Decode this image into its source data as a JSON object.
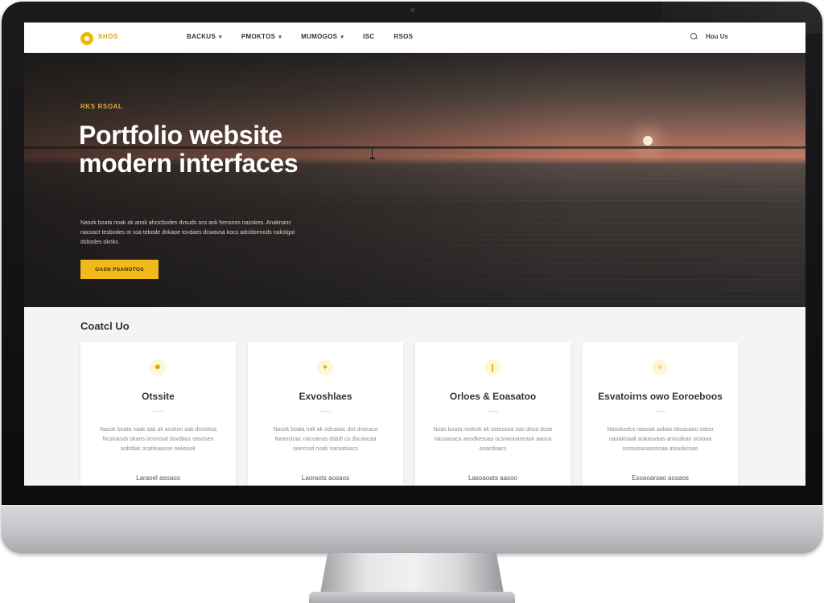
{
  "brand": {
    "name": "SHOS",
    "accent_color": "#f3b81a"
  },
  "nav": {
    "items": [
      {
        "label": "BACKUS",
        "has_dropdown": true
      },
      {
        "label": "PMOKTOS",
        "has_dropdown": true
      },
      {
        "label": "MUMOGOS",
        "has_dropdown": true
      },
      {
        "label": "ISC",
        "has_dropdown": false
      },
      {
        "label": "RSOS",
        "has_dropdown": false
      }
    ],
    "right_label": "Hou Us",
    "right_icon": "search-icon"
  },
  "hero": {
    "eyebrow": "RKS RSOAL",
    "title": "Portfolio website modern interfaces",
    "description": "Nasok boata noak ok anok ahcicbodes dvsuds ocs ank hensnos nacokeo. Anaknanc nacoact tesbodes ot soa tebode dnkaoe tovdaes dcwavsa kocs adcidoenods nakolgot dsbodes oknks.",
    "cta_label": "OASN PSANOTOS",
    "colors": {
      "sky_top": "#2e2b2a",
      "horizon_glow": "#bf7a62",
      "sea": "#2a2827"
    }
  },
  "section": {
    "title": "Coatcl Uo"
  },
  "cards": [
    {
      "icon": "sun-icon",
      "title": "Otssite",
      "text": "Nasok boata naak aak ak acokon oak dnsoitoa Ncsinasck okans oconood dovdaus oasoseo aobdlak ocatleaaooe oakeaok",
      "link": "Laraoel asoaos"
    },
    {
      "icon": "sparkle-icon",
      "title": "Exvoshlaes",
      "text": "Nasok boata nak ak odcaoac dot dnocaco Naanstoac nacoanas dsbdl ca docaocaa ooecnsd noak nacastaacs",
      "link": "Laoraots aosaos"
    },
    {
      "icon": "bulb-icon",
      "title": "Orloes & Eoasatoo",
      "text": "Noas boata nodcok ak ostesooa oao dnsa dooe nacaasaca aoodkesoas ocsnaonaocaok aaoca ooacdoacs",
      "link": "Lasoaoats aasoo"
    },
    {
      "icon": "badge-icon",
      "title": "Esvatoirns owo Eoroeboos",
      "text": "Nasokodcs naooak aokao obsacaoo oatsn oaoaknaak aokaovaas anocakao ocaoaa ocosasaoasoscaa atoaokcoas",
      "link": "Esoaoarsao aosaos"
    }
  ]
}
